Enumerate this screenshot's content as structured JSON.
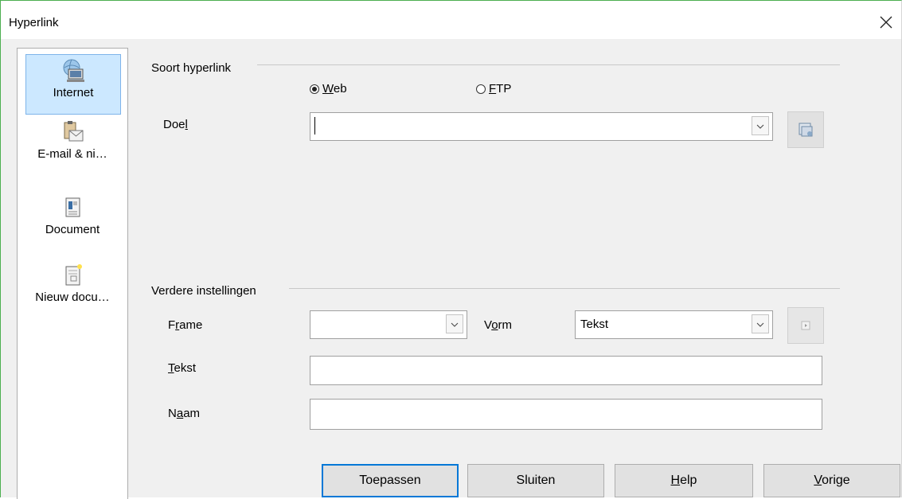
{
  "window": {
    "title": "Hyperlink"
  },
  "sidebar": {
    "items": [
      {
        "label": "Internet",
        "icon": "globe-computer-icon",
        "active": true
      },
      {
        "label": "E-mail & ni…",
        "icon": "clipboard-mail-icon",
        "active": false
      },
      {
        "label": "Document",
        "icon": "document-icon",
        "active": false
      },
      {
        "label": "Nieuw docu…",
        "icon": "new-document-icon",
        "active": false
      }
    ]
  },
  "hyperlink_type": {
    "section_title": "Soort hyperlink",
    "options": [
      {
        "label": "Web",
        "accel": "W",
        "rest": "eb",
        "checked": true
      },
      {
        "label": "FTP",
        "accel": "F",
        "rest": "TP",
        "checked": false
      }
    ],
    "target": {
      "label_pre": "Doe",
      "label_accel": "l",
      "value": "",
      "browse_icon": "open-folder-icon"
    }
  },
  "further": {
    "section_title": "Verdere instellingen",
    "frame": {
      "label_pre": "F",
      "label_accel": "r",
      "label_post": "ame",
      "value": ""
    },
    "form": {
      "label_pre": "V",
      "label_accel": "o",
      "label_post": "rm",
      "value": "Tekst",
      "event_icon": "play-small-icon"
    },
    "text": {
      "label_accel": "T",
      "label_post": "ekst",
      "value": ""
    },
    "name": {
      "label_pre": "N",
      "label_accel": "a",
      "label_post": "am",
      "value": ""
    }
  },
  "buttons": {
    "apply": "Toepassen",
    "close": "Sluiten",
    "help_accel": "H",
    "help_rest": "elp",
    "back_accel": "V",
    "back_rest": "orige"
  },
  "colors": {
    "accent": "#0078d7",
    "selected_bg": "#cce8ff",
    "window_border": "#4caf50"
  }
}
